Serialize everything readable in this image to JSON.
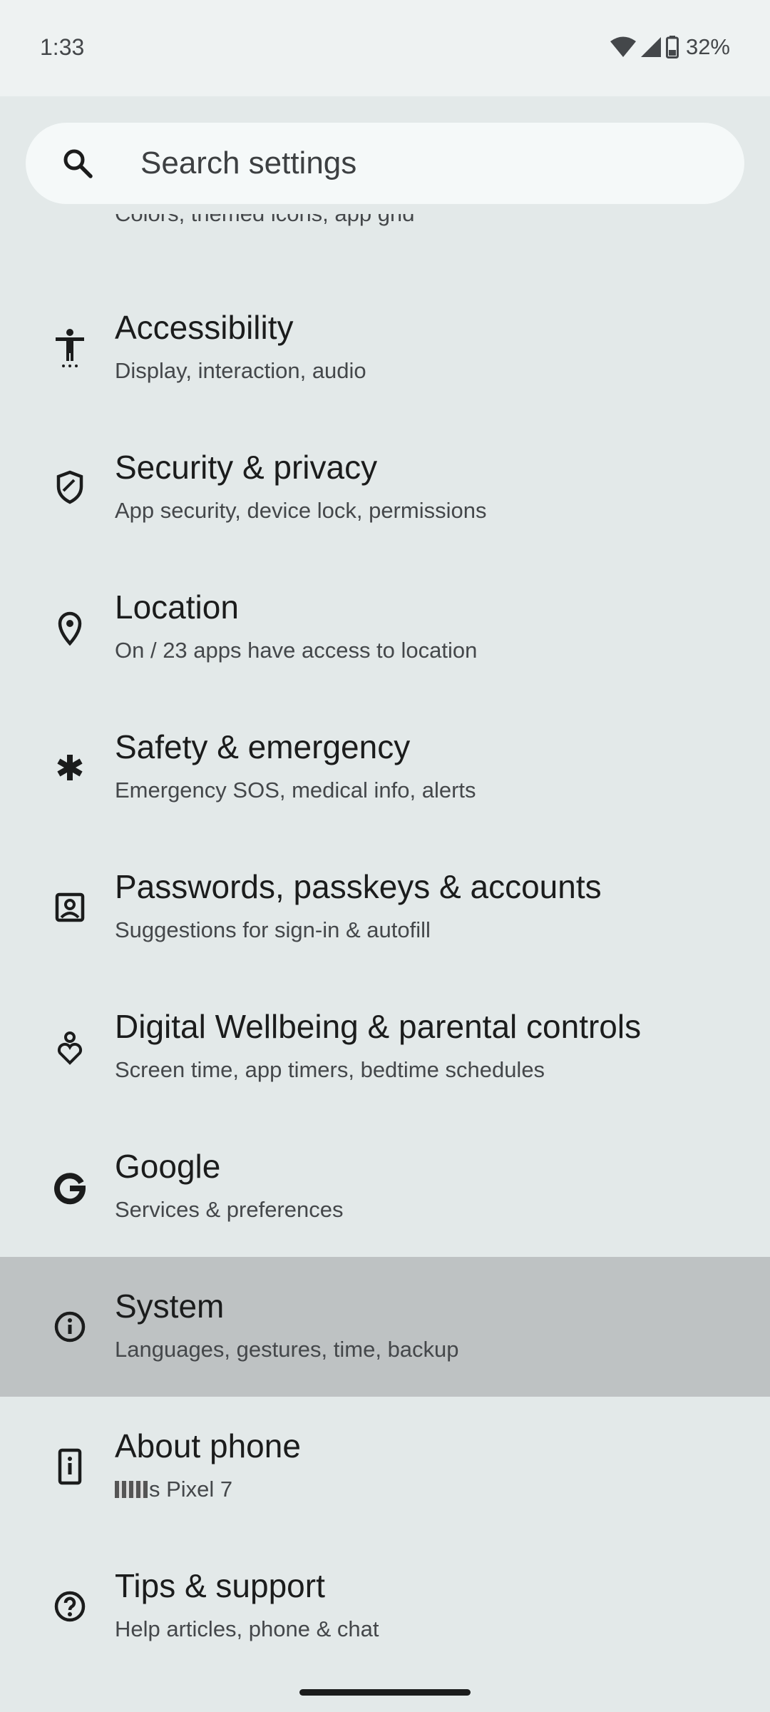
{
  "status_bar": {
    "time": "1:33",
    "battery": "32%",
    "icons": [
      "wifi-icon",
      "signal-icon",
      "battery-icon"
    ]
  },
  "search": {
    "placeholder": "Search settings",
    "icon": "search-icon"
  },
  "partial_item": {
    "subtitle": "Colors, themed icons, app grid"
  },
  "settings": [
    {
      "title": "Accessibility",
      "subtitle": "Display, interaction, audio",
      "icon": "accessibility-icon"
    },
    {
      "title": "Security & privacy",
      "subtitle": "App security, device lock, permissions",
      "icon": "shield-icon"
    },
    {
      "title": "Location",
      "subtitle": "On / 23 apps have access to location",
      "icon": "location-pin-icon"
    },
    {
      "title": "Safety & emergency",
      "subtitle": "Emergency SOS, medical info, alerts",
      "icon": "asterisk-icon"
    },
    {
      "title": "Passwords, passkeys & accounts",
      "subtitle": "Suggestions for sign-in & autofill",
      "icon": "account-box-icon"
    },
    {
      "title": "Digital Wellbeing & parental controls",
      "subtitle": "Screen time, app timers, bedtime schedules",
      "icon": "wellbeing-icon"
    },
    {
      "title": "Google",
      "subtitle": "Services & preferences",
      "icon": "google-icon"
    },
    {
      "title": "System",
      "subtitle": "Languages, gestures, time, backup",
      "icon": "info-icon"
    },
    {
      "title": "About phone",
      "subtitle": "s Pixel 7",
      "icon": "phone-icon"
    },
    {
      "title": "Tips & support",
      "subtitle": "Help articles, phone & chat",
      "icon": "help-icon"
    }
  ],
  "colors": {
    "background": "#e3e9e9",
    "highlight": "#bec2c3",
    "search_background": "#f5f9f9"
  }
}
